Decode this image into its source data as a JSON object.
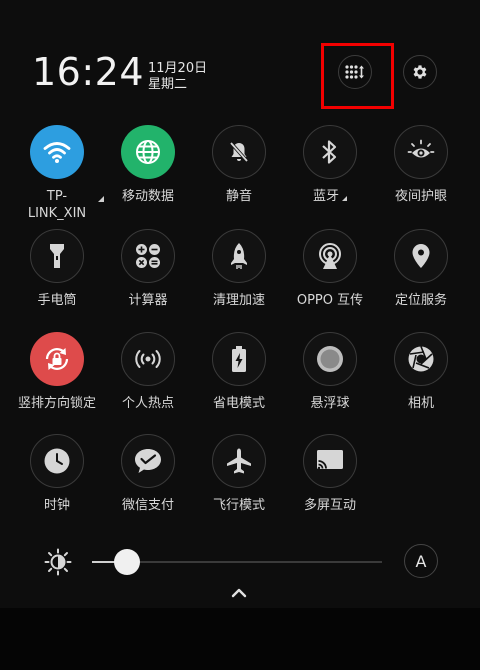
{
  "header": {
    "time": "16:24",
    "date": "11月20日",
    "weekday": "星期二"
  },
  "tiles": [
    {
      "label": "TP-\nLINK_XIN",
      "icon": "wifi-icon",
      "state": "on",
      "color": "#2d9ee0"
    },
    {
      "label": "移动数据",
      "icon": "globe-icon",
      "state": "on",
      "color": "#22b36b"
    },
    {
      "label": "静音",
      "icon": "bell-off-icon",
      "state": "off"
    },
    {
      "label": "蓝牙",
      "icon": "bluetooth-icon",
      "state": "off"
    },
    {
      "label": "夜间护眼",
      "icon": "eye-sun-icon",
      "state": "off"
    },
    {
      "label": "手电筒",
      "icon": "flashlight-icon",
      "state": "off"
    },
    {
      "label": "计算器",
      "icon": "calculator-icon",
      "state": "off"
    },
    {
      "label": "清理加速",
      "icon": "rocket-icon",
      "state": "off"
    },
    {
      "label": "OPPO 互传",
      "icon": "share-signal-icon",
      "state": "off"
    },
    {
      "label": "定位服务",
      "icon": "location-pin-icon",
      "state": "off"
    },
    {
      "label": "竖排方向锁定",
      "icon": "rotation-lock-icon",
      "state": "on",
      "color": "#de4b4b"
    },
    {
      "label": "个人热点",
      "icon": "hotspot-icon",
      "state": "off"
    },
    {
      "label": "省电模式",
      "icon": "battery-saver-icon",
      "state": "off"
    },
    {
      "label": "悬浮球",
      "icon": "floating-ball-icon",
      "state": "off"
    },
    {
      "label": "相机",
      "icon": "camera-aperture-icon",
      "state": "off"
    },
    {
      "label": "时钟",
      "icon": "clock-icon",
      "state": "off"
    },
    {
      "label": "微信支付",
      "icon": "wechat-pay-icon",
      "state": "off"
    },
    {
      "label": "飞行模式",
      "icon": "airplane-icon",
      "state": "off"
    },
    {
      "label": "多屏互动",
      "icon": "cast-icon",
      "state": "off"
    }
  ],
  "brightness": {
    "level": 0.08,
    "auto_label": "A"
  },
  "colors": {
    "highlight": "#f20000",
    "background": "#0d0d0d"
  }
}
